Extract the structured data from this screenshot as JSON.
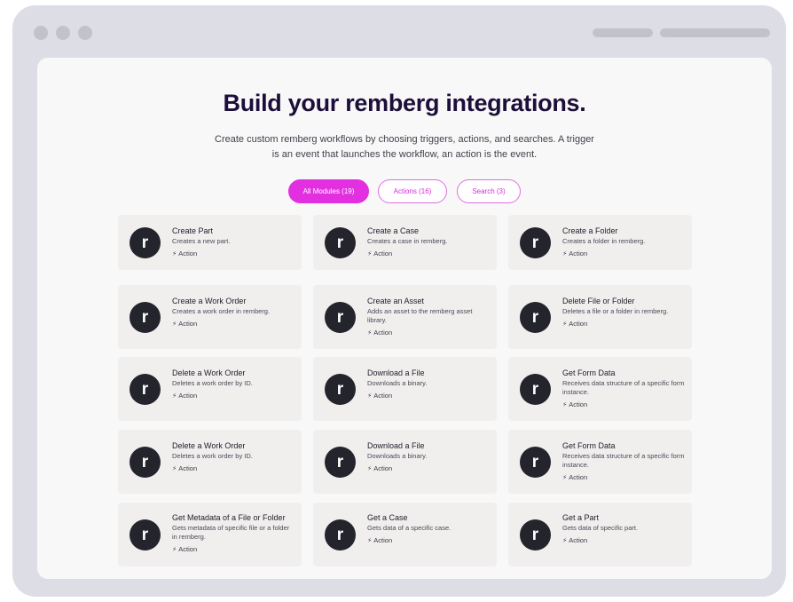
{
  "page": {
    "title": "Build your remberg integrations.",
    "subtitle": "Create custom remberg workflows by choosing triggers, actions, and searches. A trigger is an event that launches the workflow, an action is the event."
  },
  "filters": [
    {
      "label": "All Modules (19)",
      "active": true
    },
    {
      "label": "Actions (16)",
      "active": false
    },
    {
      "label": "Search (3)",
      "active": false
    }
  ],
  "cards": [
    {
      "title": "Create Part",
      "desc": "Creates a new part.",
      "tag": "Action",
      "avatar": "r"
    },
    {
      "title": "Create a Case",
      "desc": "Creates a case in remberg.",
      "tag": "Action",
      "avatar": "r"
    },
    {
      "title": "Create a Folder",
      "desc": "Creates a folder in remberg.",
      "tag": "Action",
      "avatar": "r"
    },
    {
      "title": "Create a Work Order",
      "desc": "Creates a work order in remberg.",
      "tag": "Action",
      "avatar": "r"
    },
    {
      "title": "Create an Asset",
      "desc": "Adds an asset to the remberg asset library.",
      "tag": "Action",
      "avatar": "r"
    },
    {
      "title": "Delete File or Folder",
      "desc": "Deletes a file or a folder in remberg.",
      "tag": "Action",
      "avatar": "r"
    },
    {
      "title": "Delete a Work Order",
      "desc": "Deletes a work order by ID.",
      "tag": "Action",
      "avatar": "r"
    },
    {
      "title": "Download a File",
      "desc": "Downloads a binary.",
      "tag": "Action",
      "avatar": "r"
    },
    {
      "title": "Get Form Data",
      "desc": "Receives data structure of a specific form instance.",
      "tag": "Action",
      "avatar": "r"
    },
    {
      "title": "Delete a Work Order",
      "desc": "Deletes a work order by ID.",
      "tag": "Action",
      "avatar": "r"
    },
    {
      "title": "Download a File",
      "desc": "Downloads a binary.",
      "tag": "Action",
      "avatar": "r"
    },
    {
      "title": "Get Form Data",
      "desc": "Receives data structure of a specific form instance.",
      "tag": "Action",
      "avatar": "r"
    },
    {
      "title": "Get Metadata of a File or Folder",
      "desc": "Gets metadata of specific file or a folder in remberg.",
      "tag": "Action",
      "avatar": "r"
    },
    {
      "title": "Get a Case",
      "desc": "Gets data of a specific case.",
      "tag": "Action",
      "avatar": "r"
    },
    {
      "title": "Get a Part",
      "desc": "Gets data of specific part.",
      "tag": "Action",
      "avatar": "r"
    }
  ],
  "icons": {
    "tag": "bolt-icon"
  },
  "colors": {
    "accent": "#e230e0",
    "title": "#1c0f3a",
    "avatar": "#24242c",
    "card": "#f1eeee"
  }
}
